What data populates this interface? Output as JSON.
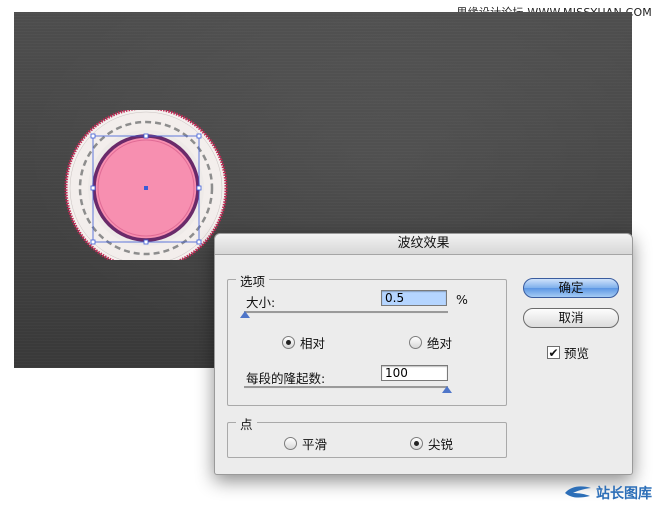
{
  "watermark": "思缘设计论坛 WWW.MISSYUAN.COM",
  "dialog": {
    "title": "波纹效果",
    "options_group": "选项",
    "size_label": "大小:",
    "size_value": "0.5",
    "size_unit": "%",
    "size_slider_fraction": 0.0,
    "relative_label": "相对",
    "absolute_label": "绝对",
    "relative_selected": true,
    "ridges_label": "每段的隆起数:",
    "ridges_value": "100",
    "ridges_slider_fraction": 1.0,
    "points_group": "点",
    "smooth_label": "平滑",
    "corner_label": "尖锐",
    "corner_selected": true,
    "ok_label": "确定",
    "cancel_label": "取消",
    "preview_label": "预览",
    "preview_checked": true
  },
  "logo": {
    "text": "站长图库"
  },
  "colors": {
    "pink": "#f78fb0",
    "ring": "#c12a55",
    "primary_button": "#6aa3e8",
    "selection_blue": "#3b5bd6"
  }
}
